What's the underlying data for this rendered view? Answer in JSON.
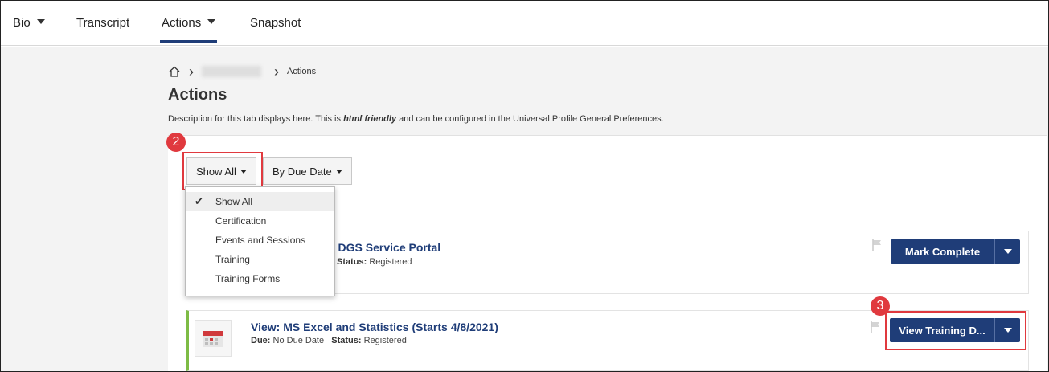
{
  "nav": {
    "tabs": [
      {
        "label": "Bio"
      },
      {
        "label": "Transcript"
      },
      {
        "label": "Actions"
      },
      {
        "label": "Snapshot"
      }
    ]
  },
  "breadcrumb": {
    "current": "Actions"
  },
  "page": {
    "title": "Actions",
    "description_before": "Description for this tab displays here. This is ",
    "description_em": "html friendly",
    "description_after": " and can be configured in the Universal Profile General Preferences."
  },
  "filters": {
    "show_label": "Show All",
    "sort_label": "By Due Date"
  },
  "menu": {
    "items": [
      {
        "label": "Show All",
        "checked": true
      },
      {
        "label": "Certification"
      },
      {
        "label": "Events and Sessions"
      },
      {
        "label": "Training"
      },
      {
        "label": "Training Forms"
      }
    ]
  },
  "cards": [
    {
      "title": ": DGS Service Portal",
      "status_label": "Status:",
      "status_value": "Registered",
      "action_label": "Mark Complete"
    },
    {
      "title": "View: MS Excel and Statistics (Starts 4/8/2021)",
      "due_label": "Due:",
      "due_value": "No Due Date",
      "status_label": "Status:",
      "status_value": "Registered",
      "action_label": "View Training D..."
    }
  ],
  "badges": [
    "2",
    "3"
  ],
  "colors": {
    "primary": "#1f3d78",
    "highlight": "#e0393e",
    "active_accent": "#7dbb45"
  }
}
